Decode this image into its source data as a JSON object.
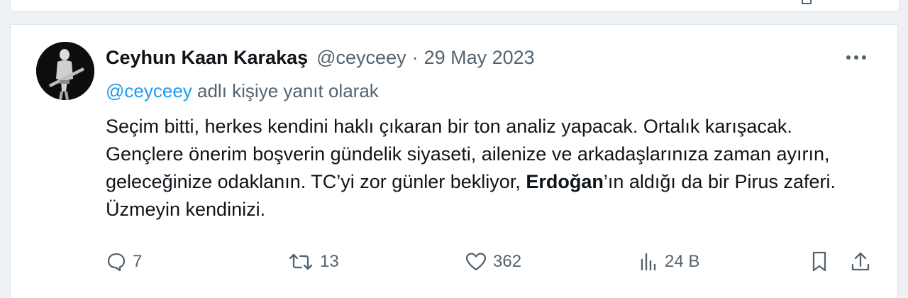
{
  "tweet": {
    "author_name": "Ceyhun Kaan Karakaş",
    "handle": "@ceyceey",
    "separator": "·",
    "date": "29 May 2023",
    "reply_to": {
      "mention": "@ceyceey",
      "suffix": " adlı kişiye yanıt olarak"
    },
    "body": {
      "part1": "Seçim bitti, herkes kendini haklı çıkaran bir ton analiz yapacak. Ortalık karışacak. Gençlere önerim boşverin gündelik siyaseti, ailenize ve arkadaşlarınıza zaman ayırın, geleceğinize odaklanın. TC’yi zor günler bekliyor, ",
      "bold": "Erdoğan",
      "part2": "’ın aldığı da bir Pirus zaferi. Üzmeyin kendinizi."
    },
    "actions": {
      "replies": "7",
      "retweets": "13",
      "likes": "362",
      "views": "24 B"
    }
  },
  "icons": {
    "more": "more-horizontal-icon",
    "reply": "speech-bubble-icon",
    "retweet": "retweet-arrows-icon",
    "like": "heart-icon",
    "views": "bar-chart-icon",
    "bookmark": "bookmark-icon",
    "share": "share-upload-icon"
  },
  "colors": {
    "text": "#0f1419",
    "secondary": "#536471",
    "link": "#1d9bf0",
    "background": "#eef1f4",
    "card": "#ffffff"
  }
}
